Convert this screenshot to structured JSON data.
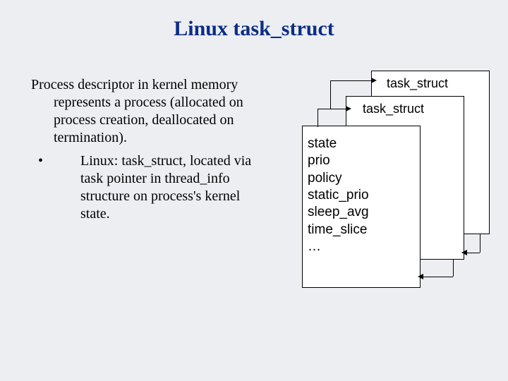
{
  "title": "Linux task_struct",
  "paragraph": "Process descriptor in kernel memory represents a process (allocated on process creation, deallocated on termination).",
  "bullet": "Linux: task_struct, located via task pointer in thread_info structure on process's kernel state.",
  "diagram": {
    "back_label": "task_struct",
    "mid_label": "task_struct",
    "fields": "state\nprio\npolicy\nstatic_prio\nsleep_avg\ntime_slice\n…"
  }
}
